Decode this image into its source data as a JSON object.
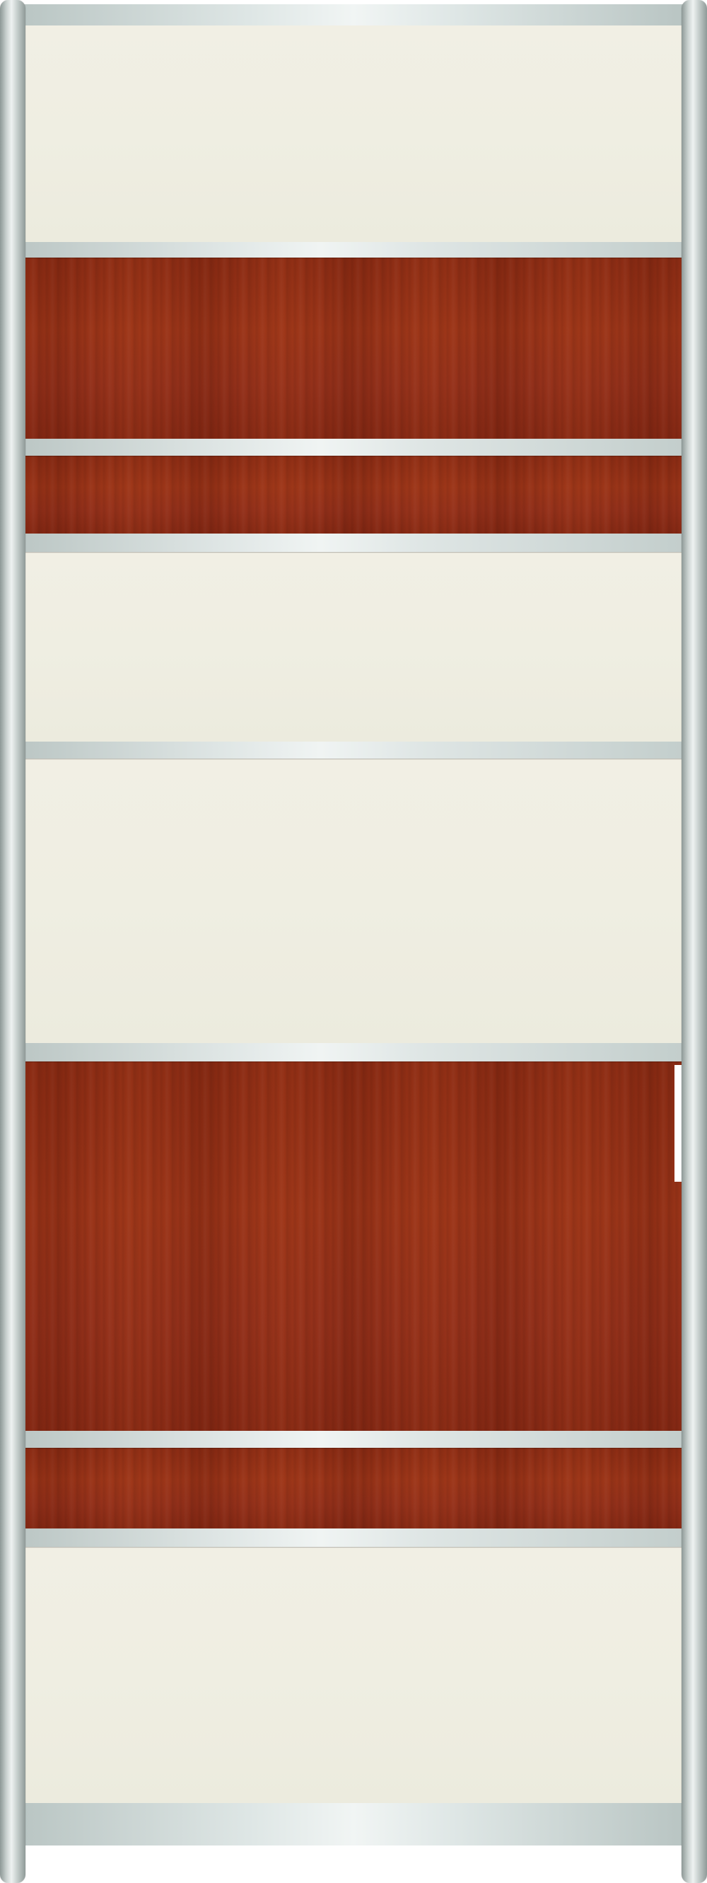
{
  "door": {
    "panels": [
      {
        "material": "cream",
        "color": "#efeee2"
      },
      {
        "material": "wood",
        "color": "#93301a"
      },
      {
        "material": "wood",
        "color": "#93301a"
      },
      {
        "material": "cream",
        "color": "#efeee2"
      },
      {
        "material": "cream",
        "color": "#efeee2"
      },
      {
        "material": "wood",
        "color": "#93301a"
      },
      {
        "material": "wood",
        "color": "#93301a"
      },
      {
        "material": "cream",
        "color": "#efeee2"
      }
    ],
    "frame_color": "#c9d1cf"
  }
}
